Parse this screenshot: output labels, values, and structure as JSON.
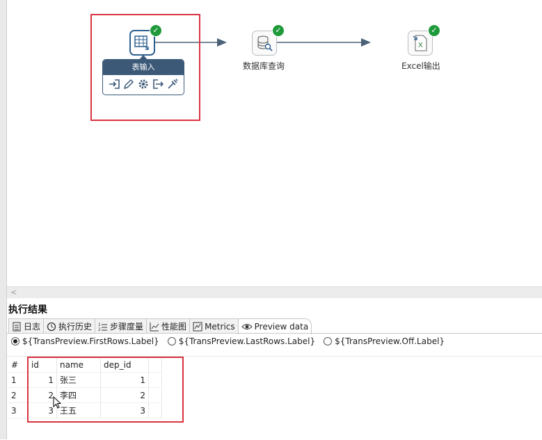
{
  "canvas": {
    "steps": [
      {
        "name": "表输入",
        "status": "ok"
      },
      {
        "name": "数据库查询",
        "status": "ok"
      },
      {
        "name": "Excel输出",
        "status": "ok"
      }
    ],
    "selected_step_popup": {
      "title": "表输入",
      "icons": [
        "input-icon",
        "edit-icon",
        "settings-icon",
        "output-icon",
        "inject-icon"
      ]
    },
    "scroll_arrow": "<"
  },
  "results": {
    "title": "执行结果",
    "tabs": [
      {
        "label": "日志",
        "icon": "log-icon"
      },
      {
        "label": "执行历史",
        "icon": "history-icon"
      },
      {
        "label": "步骤度量",
        "icon": "metrics-list-icon"
      },
      {
        "label": "性能图",
        "icon": "chart-icon"
      },
      {
        "label": "Metrics",
        "icon": "metrics-icon"
      },
      {
        "label": "Preview data",
        "icon": "eye-icon",
        "active": true
      }
    ],
    "preview_options": [
      {
        "label": "${TransPreview.FirstRows.Label}",
        "selected": true
      },
      {
        "label": "${TransPreview.LastRows.Label}",
        "selected": false
      },
      {
        "label": "${TransPreview.Off.Label}",
        "selected": false
      }
    ],
    "table": {
      "row_number_header": "#",
      "columns": [
        "id",
        "name",
        "dep_id"
      ],
      "rows": [
        {
          "n": "1",
          "id": "1",
          "name": "张三",
          "dep_id": "1"
        },
        {
          "n": "2",
          "id": "2",
          "name": "李四",
          "dep_id": "2"
        },
        {
          "n": "3",
          "id": "3",
          "name": "王五",
          "dep_id": "3"
        }
      ]
    }
  }
}
